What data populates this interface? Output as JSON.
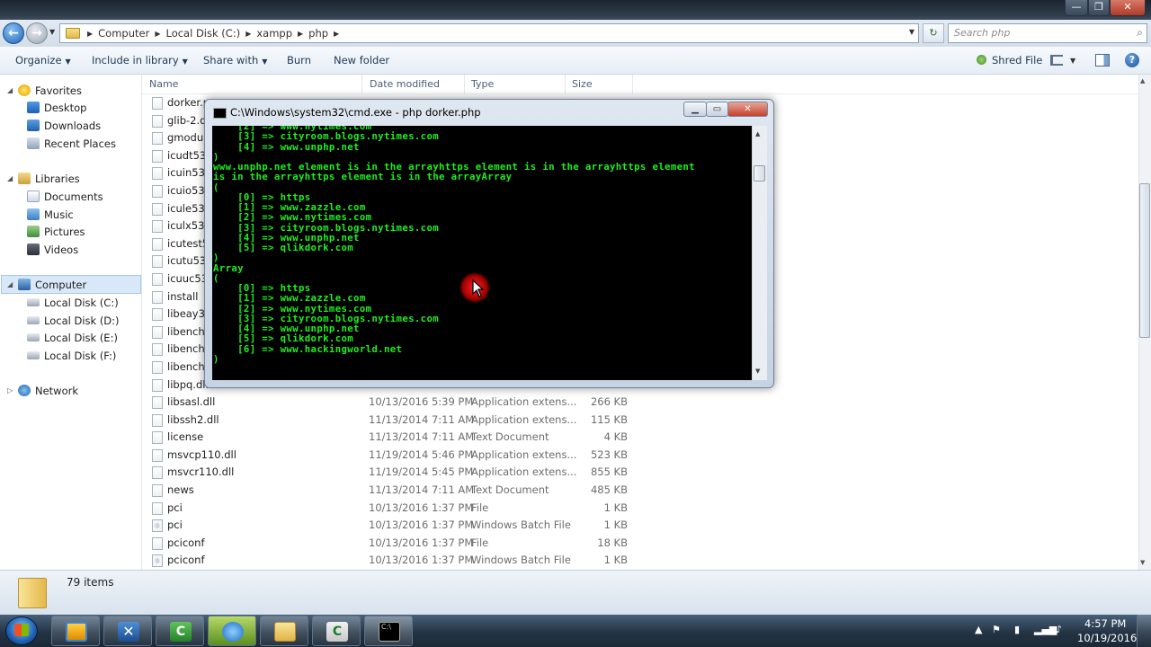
{
  "address": {
    "breadcrumbs": [
      "Computer",
      "Local Disk (C:)",
      "xampp",
      "php"
    ],
    "search_placeholder": "Search php"
  },
  "toolbar": {
    "organize": "Organize",
    "include": "Include in library",
    "share": "Share with",
    "burn": "Burn",
    "new_folder": "New folder",
    "shred": "Shred File"
  },
  "nav": {
    "favorites": "Favorites",
    "desktop": "Desktop",
    "downloads": "Downloads",
    "recent": "Recent Places",
    "libraries": "Libraries",
    "documents": "Documents",
    "music": "Music",
    "pictures": "Pictures",
    "videos": "Videos",
    "computer": "Computer",
    "disk_c": "Local Disk (C:)",
    "disk_d": "Local Disk (D:)",
    "disk_e": "Local Disk (E:)",
    "disk_f": "Local Disk (F:)",
    "network": "Network"
  },
  "columns": {
    "name": "Name",
    "date": "Date modified",
    "type": "Type",
    "size": "Size"
  },
  "files": [
    {
      "name": "dorker.p",
      "date": "",
      "type": "",
      "size": ""
    },
    {
      "name": "glib-2.dl",
      "date": "",
      "type": "",
      "size": ""
    },
    {
      "name": "gmodul",
      "date": "",
      "type": "",
      "size": ""
    },
    {
      "name": "icudt53.",
      "date": "",
      "type": "",
      "size": ""
    },
    {
      "name": "icuin53.",
      "date": "",
      "type": "",
      "size": ""
    },
    {
      "name": "icuio53.",
      "date": "",
      "type": "",
      "size": ""
    },
    {
      "name": "icule53.",
      "date": "",
      "type": "",
      "size": ""
    },
    {
      "name": "iculx53.",
      "date": "",
      "type": "",
      "size": ""
    },
    {
      "name": "icutest5",
      "date": "",
      "type": "",
      "size": ""
    },
    {
      "name": "icutu53.",
      "date": "",
      "type": "",
      "size": ""
    },
    {
      "name": "icuuc53.",
      "date": "",
      "type": "",
      "size": ""
    },
    {
      "name": "install",
      "date": "",
      "type": "",
      "size": ""
    },
    {
      "name": "libeay32",
      "date": "",
      "type": "",
      "size": ""
    },
    {
      "name": "libencha",
      "date": "",
      "type": "",
      "size": ""
    },
    {
      "name": "libencha",
      "date": "",
      "type": "",
      "size": ""
    },
    {
      "name": "libencha",
      "date": "",
      "type": "",
      "size": ""
    },
    {
      "name": "libpq.dll",
      "date": "",
      "type": "",
      "size": ""
    },
    {
      "name": "libsasl.dll",
      "date": "10/13/2016 5:39 PM",
      "type": "Application extens...",
      "size": "266 KB"
    },
    {
      "name": "libssh2.dll",
      "date": "11/13/2014 7:11 AM",
      "type": "Application extens...",
      "size": "115 KB"
    },
    {
      "name": "license",
      "date": "11/13/2014 7:11 AM",
      "type": "Text Document",
      "size": "4 KB"
    },
    {
      "name": "msvcp110.dll",
      "date": "11/19/2014 5:46 PM",
      "type": "Application extens...",
      "size": "523 KB"
    },
    {
      "name": "msvcr110.dll",
      "date": "11/19/2014 5:45 PM",
      "type": "Application extens...",
      "size": "855 KB"
    },
    {
      "name": "news",
      "date": "11/13/2014 7:11 AM",
      "type": "Text Document",
      "size": "485 KB"
    },
    {
      "name": "pci",
      "date": "10/13/2016 1:37 PM",
      "type": "File",
      "size": "1 KB"
    },
    {
      "name": "pci",
      "date": "10/13/2016 1:37 PM",
      "type": "Windows Batch File",
      "size": "1 KB"
    },
    {
      "name": "pciconf",
      "date": "10/13/2016 1:37 PM",
      "type": "File",
      "size": "18 KB"
    },
    {
      "name": "pciconf",
      "date": "10/13/2016 1:37 PM",
      "type": "Windows Batch File",
      "size": "1 KB"
    }
  ],
  "details": {
    "item_count": "79 items"
  },
  "cmd": {
    "title": "C:\\Windows\\system32\\cmd.exe - php  dorker.php",
    "output": "    [2] => www.nytimes.com\n    [3] => cityroom.blogs.nytimes.com\n    [4] => www.unphp.net\n)\nwww.unphp.net element is in the arrayhttps element is in the arrayhttps element\nis in the arrayhttps element is in the arrayArray\n(\n    [0] => https\n    [1] => www.zazzle.com\n    [2] => www.nytimes.com\n    [3] => cityroom.blogs.nytimes.com\n    [4] => www.unphp.net\n    [5] => qlikdork.com\n)\nArray\n(\n    [0] => https\n    [1] => www.zazzle.com\n    [2] => www.nytimes.com\n    [3] => cityroom.blogs.nytimes.com\n    [4] => www.unphp.net\n    [5] => qlikdork.com\n    [6] => www.hackingworld.net\n)"
  },
  "clock": {
    "time": "4:57 PM",
    "date": "10/19/2016"
  }
}
